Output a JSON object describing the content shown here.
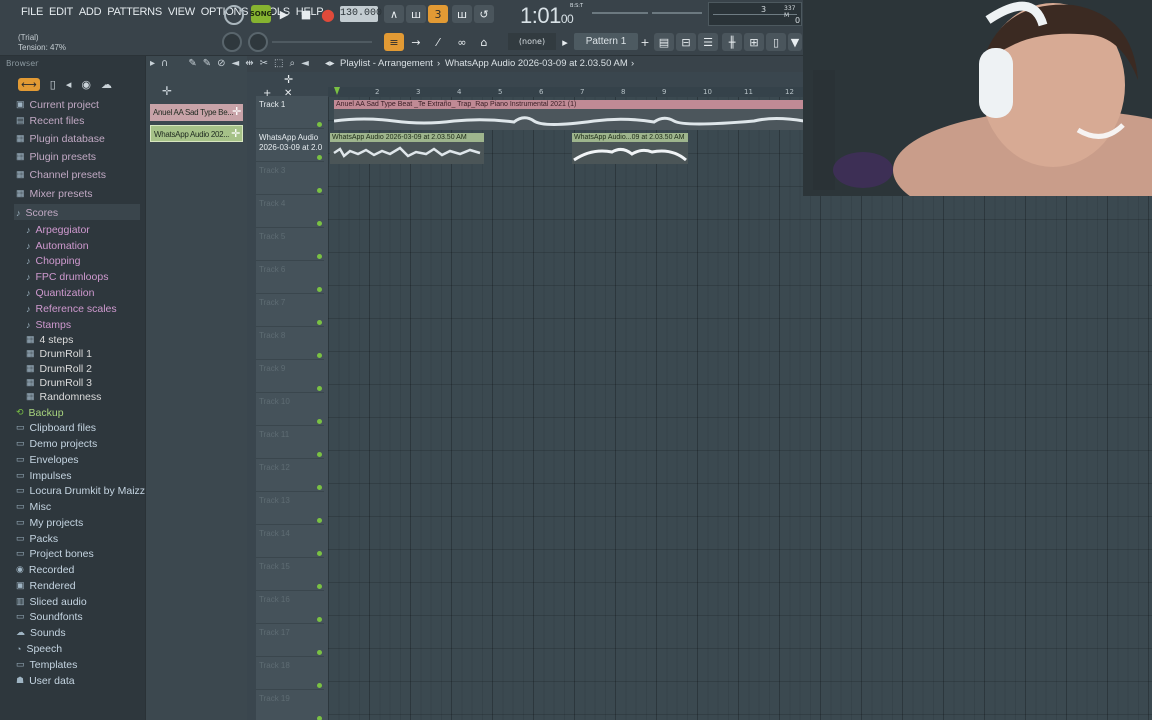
{
  "menu": [
    "FILE",
    "EDIT",
    "ADD",
    "PATTERNS",
    "VIEW",
    "OPTIONS",
    "TOOLS",
    "HELP"
  ],
  "hint": {
    "line1": "(Trial)",
    "line2": "Tension:  47%"
  },
  "transport": {
    "song_label": "SONG",
    "tempo": "130.000",
    "time": "1:01",
    "time_ticks": "00",
    "time_unit": "B:S:T"
  },
  "monitor": {
    "value1": "3",
    "value2": "337 M",
    "value3": "0"
  },
  "snap": "(none)",
  "pattern": "Pattern 1",
  "browser": {
    "title": "Browser",
    "items": [
      {
        "label": "Current project",
        "style": "dim",
        "icon": "project-icon"
      },
      {
        "label": "Recent files",
        "style": "dim",
        "icon": "recent-icon"
      },
      {
        "label": "Plugin database",
        "style": "dim",
        "icon": "plugin-icon"
      },
      {
        "label": "Plugin presets",
        "style": "dim",
        "icon": "plugin-icon"
      },
      {
        "label": "Channel presets",
        "style": "dim",
        "icon": "plugin-icon"
      },
      {
        "label": "Mixer presets",
        "style": "dim",
        "icon": "plugin-icon"
      },
      {
        "label": "Scores",
        "style": "dim",
        "icon": "note-icon"
      },
      {
        "label": "Arpeggiator",
        "style": "sub",
        "icon": "note-icon"
      },
      {
        "label": "Automation",
        "style": "sub",
        "icon": "note-icon"
      },
      {
        "label": "Chopping",
        "style": "sub",
        "icon": "note-icon"
      },
      {
        "label": "FPC drumloops",
        "style": "sub",
        "icon": "note-icon"
      },
      {
        "label": "Quantization",
        "style": "sub",
        "icon": "note-icon"
      },
      {
        "label": "Reference scales",
        "style": "sub",
        "icon": "note-icon"
      },
      {
        "label": "Stamps",
        "style": "sub",
        "icon": "note-icon"
      },
      {
        "label": "4 steps",
        "style": "step",
        "icon": "score-icon"
      },
      {
        "label": "DrumRoll 1",
        "style": "step",
        "icon": "score-icon"
      },
      {
        "label": "DrumRoll 2",
        "style": "step",
        "icon": "score-icon"
      },
      {
        "label": "DrumRoll 3",
        "style": "step",
        "icon": "score-icon"
      },
      {
        "label": "Randomness",
        "style": "step",
        "icon": "score-icon"
      },
      {
        "label": "Backup",
        "style": "green",
        "icon": "backup-icon"
      },
      {
        "label": "Clipboard files",
        "style": "plain",
        "icon": "folder-icon"
      },
      {
        "label": "Demo projects",
        "style": "plain",
        "icon": "folder-icon"
      },
      {
        "label": "Envelopes",
        "style": "plain",
        "icon": "folder-icon"
      },
      {
        "label": "Impulses",
        "style": "plain",
        "icon": "folder-icon"
      },
      {
        "label": "Locura Drumkit by Maizzeno",
        "style": "plain",
        "icon": "folder-icon"
      },
      {
        "label": "Misc",
        "style": "plain",
        "icon": "folder-icon"
      },
      {
        "label": "My projects",
        "style": "plain",
        "icon": "folder-icon"
      },
      {
        "label": "Packs",
        "style": "plain",
        "icon": "folder-icon"
      },
      {
        "label": "Project bones",
        "style": "plain",
        "icon": "folder-icon"
      },
      {
        "label": "Recorded",
        "style": "plain",
        "icon": "mic-icon"
      },
      {
        "label": "Rendered",
        "style": "plain",
        "icon": "render-icon"
      },
      {
        "label": "Sliced audio",
        "style": "plain",
        "icon": "slice-icon"
      },
      {
        "label": "Soundfonts",
        "style": "plain",
        "icon": "folder-icon"
      },
      {
        "label": "Sounds",
        "style": "plain",
        "icon": "cloud-icon"
      },
      {
        "label": "Speech",
        "style": "plain",
        "icon": "speech-icon"
      },
      {
        "label": "Templates",
        "style": "plain",
        "icon": "folder-icon"
      },
      {
        "label": "User data",
        "style": "plain",
        "icon": "user-icon"
      }
    ]
  },
  "channels": [
    {
      "label": "Anuel AA Sad Type Be..."
    },
    {
      "label": "WhatsApp Audio 202..."
    }
  ],
  "playlist": {
    "title": "Playlist - Arrangement",
    "breadcrumb": "WhatsApp Audio 2026-03-09 at 2.03.50 AM",
    "ruler": [
      "2",
      "3",
      "4",
      "5",
      "6",
      "7",
      "8",
      "9",
      "10",
      "11",
      "12"
    ],
    "tracks": [
      {
        "label": "Track 1",
        "named": true
      },
      {
        "label": "WhatsApp Audio 2026-03-09 at 2.0",
        "named": true
      },
      {
        "label": "Track 3"
      },
      {
        "label": "Track 4"
      },
      {
        "label": "Track 5"
      },
      {
        "label": "Track 6"
      },
      {
        "label": "Track 7"
      },
      {
        "label": "Track 8"
      },
      {
        "label": "Track 9"
      },
      {
        "label": "Track 10"
      },
      {
        "label": "Track 11"
      },
      {
        "label": "Track 12"
      },
      {
        "label": "Track 13"
      },
      {
        "label": "Track 14"
      },
      {
        "label": "Track 15"
      },
      {
        "label": "Track 16"
      },
      {
        "label": "Track 17"
      },
      {
        "label": "Track 18"
      },
      {
        "label": "Track 19"
      }
    ],
    "clips": {
      "beat": "Anuel AA Sad Type Beat _Te Extraño_ Trap_Rap Piano Instrumental 2021 (1)",
      "audio1": "WhatsApp Audio 2026-03-09 at 2.03.50 AM",
      "audio2": "WhatsApp Audio...09 at 2.03.50 AM"
    }
  }
}
